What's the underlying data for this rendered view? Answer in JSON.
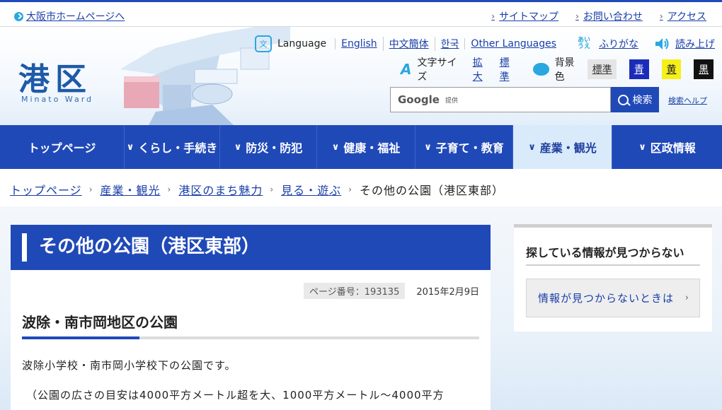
{
  "top": {
    "osaka_link": "大阪市ホームページへ",
    "links": [
      "サイトマップ",
      "お問い合わせ",
      "アクセス"
    ]
  },
  "header": {
    "logo_title": "港区",
    "logo_sub": "Minato Ward",
    "language_label": "Language",
    "languages": [
      "English",
      "中文簡体",
      "한국",
      "Other Languages"
    ],
    "furigana_icon": "あい うえ",
    "furigana": "ふりがな",
    "read_aloud": "読み上げ",
    "text_size_label": "文字サイズ",
    "text_size_enlarge": "拡大",
    "text_size_standard": "標準",
    "bg_color_label": "背景色",
    "bg_standard": "標準",
    "bg_blue": "青",
    "bg_yellow": "黄",
    "bg_black": "黒",
    "search_google": "Google",
    "search_provided": "提供",
    "search_button": "検索",
    "search_help": "検索ヘルプ"
  },
  "nav": {
    "items": [
      "トップページ",
      "くらし・手続き",
      "防災・防犯",
      "健康・福祉",
      "子育て・教育",
      "産業・観光",
      "区政情報"
    ],
    "active": "産業・観光"
  },
  "breadcrumb": {
    "items": [
      "トップページ",
      "産業・観光",
      "港区のまち魅力",
      "見る・遊ぶ"
    ],
    "current": "その他の公園（港区東部）"
  },
  "main": {
    "title": "その他の公園（港区東部）",
    "page_number": "ページ番号：193135",
    "date": "2015年2月9日",
    "heading": "波除・南市岡地区の公園",
    "para1": "波除小学校・南市岡小学校下の公園です。",
    "para2": "（公園の広さの目安は4000平方メートル超を大、1000平方メートル～4000平方"
  },
  "side": {
    "title": "探している情報が見つからない",
    "button": "情報が見つからないときは"
  },
  "colors": {
    "primary": "#2049b8",
    "accent": "#2aa7e0",
    "nav_active_bg": "#d9eafb"
  }
}
